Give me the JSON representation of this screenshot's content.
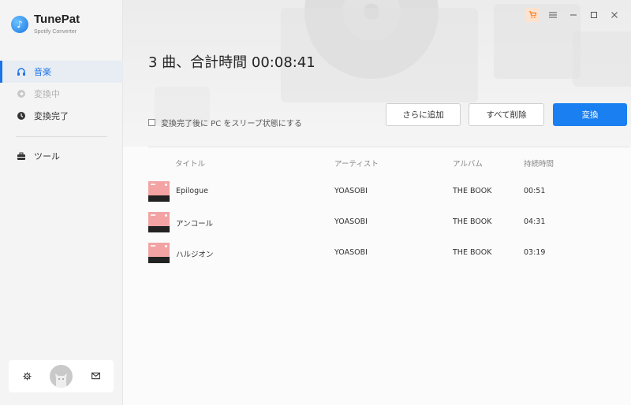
{
  "app": {
    "name": "TunePat",
    "subtitle": "Spotify Converter"
  },
  "sidebar": {
    "items": [
      {
        "label": "音楽",
        "icon": "headphones-icon",
        "state": "active"
      },
      {
        "label": "変換中",
        "icon": "converting-icon",
        "state": "disabled"
      },
      {
        "label": "変換完了",
        "icon": "clock-icon",
        "state": "normal"
      }
    ],
    "tools": {
      "label": "ツール",
      "icon": "toolbox-icon"
    },
    "bottom": {
      "settings_icon": "gear-icon",
      "avatar": "avatar",
      "mail_icon": "mail-icon"
    }
  },
  "header": {
    "title": "3 曲、合計時間 00:08:41",
    "window_controls": [
      "cart-icon",
      "menu-icon",
      "minimize-icon",
      "maximize-icon",
      "close-icon"
    ]
  },
  "actions": {
    "sleep_label": "変換完了後に PC をスリープ状態にする",
    "add_more": "さらに追加",
    "delete_all": "すべて削除",
    "convert": "変換"
  },
  "table": {
    "columns": [
      "タイトル",
      "アーティスト",
      "アルバム",
      "持続時間"
    ],
    "rows": [
      {
        "title": "Epilogue",
        "artist": "YOASOBI",
        "album": "THE BOOK",
        "duration": "00:51"
      },
      {
        "title": "アンコール",
        "artist": "YOASOBI",
        "album": "THE BOOK",
        "duration": "04:31"
      },
      {
        "title": "ハルジオン",
        "artist": "YOASOBI",
        "album": "THE BOOK",
        "duration": "03:19"
      }
    ]
  },
  "colors": {
    "accent": "#1a7ff0",
    "active_bg": "#e8ecf3",
    "thumb": "#f3a3a3"
  }
}
